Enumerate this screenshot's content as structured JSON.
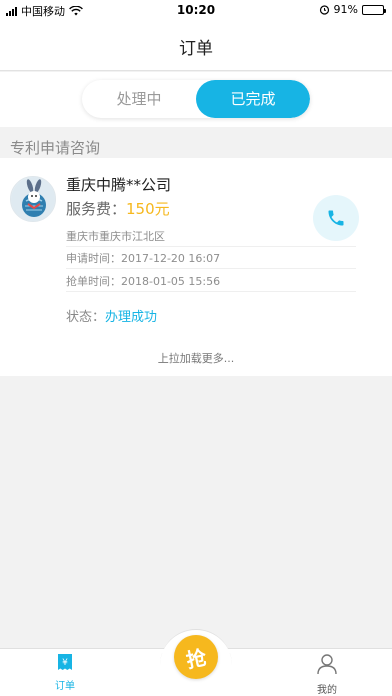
{
  "status_bar": {
    "carrier": "中国移动",
    "time": "10:20",
    "battery": "91%",
    "battery_level": 0.91
  },
  "header": {
    "title": "订单"
  },
  "segments": [
    {
      "label": "处理中",
      "active": false
    },
    {
      "label": "已完成",
      "active": true
    }
  ],
  "section": {
    "label": "专利申请咨询"
  },
  "order": {
    "company": "重庆中腾**公司",
    "fee_label": "服务费：",
    "fee_value": "150元",
    "address": "重庆市重庆市江北区",
    "apply_label": "申请时间：",
    "apply_time": "2017-12-20 16:07",
    "grab_label": "抢单时间：",
    "grab_time": "2018-01-05 15:56",
    "status_label": "状态：",
    "status_value": "办理成功"
  },
  "load_more": "上拉加载更多...",
  "tabbar": {
    "orders": "订单",
    "grab": "抢",
    "mine": "我的"
  },
  "colors": {
    "accent": "#17b4e4",
    "fee": "#f6b81e",
    "grab_button": "#f6b81e"
  },
  "icons": [
    "signal-icon",
    "wifi-icon",
    "alarm-icon",
    "battery-icon",
    "avatar-rabbit-icon",
    "phone-icon",
    "orders-icon",
    "grab-icon",
    "user-icon"
  ]
}
